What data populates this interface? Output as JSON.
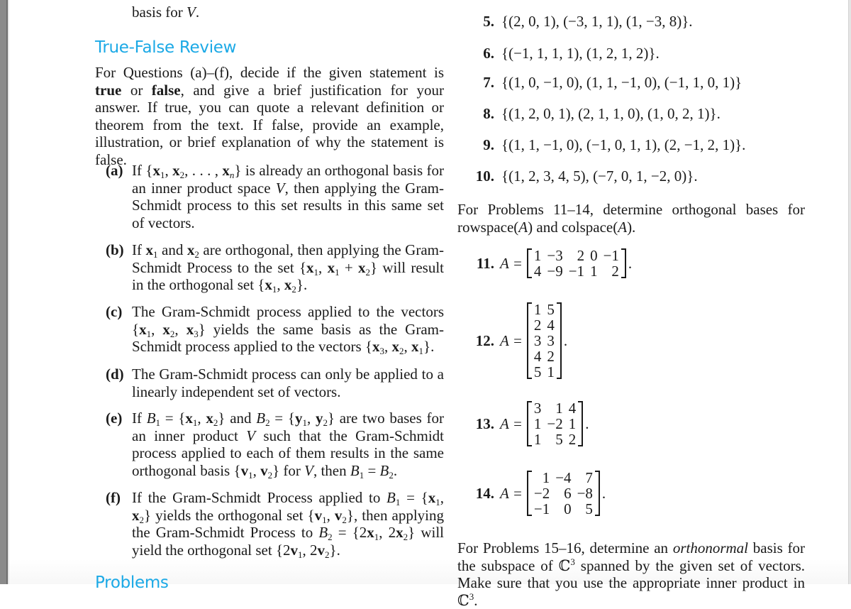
{
  "left_column": {
    "fragment_top": "basis for V.",
    "basis_for_prefix": "basis for ",
    "basis_for_var": "V",
    "basis_for_suffix": ".",
    "tf_heading": "True-False Review",
    "intro": {
      "p1": "For Questions (a)–(f), decide if the given statement is ",
      "true": "true",
      "p2": " or ",
      "false": "false",
      "p3": ", and give a brief justification for your answer. If true, you can quote a relevant definition or theorem from the text. If false, provide an example, illustration, or brief explanation of why the statement is false."
    },
    "items": [
      {
        "label": "(a)",
        "text": "If {x₁, x₂, …, xₙ} is already an orthogonal basis for an inner product space V, then applying the Gram-Schmidt process to this set results in this same set of vectors."
      },
      {
        "label": "(b)",
        "text": "If x₁ and x₂ are orthogonal, then applying the Gram-Schmidt Process to the set {x₁, x₁ + x₂} will result in the orthogonal set {x₁, x₂}."
      },
      {
        "label": "(c)",
        "text": "The Gram-Schmidt process applied to the vectors {x₁, x₂, x₃} yields the same basis as the Gram-Schmidt process applied to the vectors {x₃, x₂, x₁}."
      },
      {
        "label": "(d)",
        "text": "The Gram-Schmidt process can only be applied to a linearly independent set of vectors."
      },
      {
        "label": "(e)",
        "text": "If B₁ = {x₁, x₂} and B₂ = {y₁, y₂} are two bases for an inner product V such that the Gram-Schmidt process applied to each of them results in the same orthogonal basis {v₁, v₂} for V, then B₁ = B₂."
      },
      {
        "label": "(f)",
        "text": "If the Gram-Schmidt Process applied to B₁ = {x₁, x₂} yields the orthogonal set {v₁, v₂}, then applying the Gram-Schmidt Process to B₂ = {2x₁, 2x₂} will yield the orthogonal set {2v₁, 2v₂}."
      }
    ],
    "problems_heading": "Problems"
  },
  "right_column": {
    "vector_problems": [
      {
        "num": "5.",
        "text": "{(2, 0, 1), (−3, 1, 1), (1, −3, 8)}."
      },
      {
        "num": "6.",
        "text": "{(−1, 1, 1, 1), (1, 2, 1, 2)}."
      },
      {
        "num": "7.",
        "text": "{(1, 0, −1, 0), (1, 1, −1, 0), (−1, 1, 0, 1)}"
      },
      {
        "num": "8.",
        "text": "{(1, 2, 0, 1), (2, 1, 1, 0), (1, 0, 2, 1)}."
      },
      {
        "num": "9.",
        "text": "{(1, 1, −1, 0), (−1, 0, 1, 1), (2, −1, 2, 1)}."
      },
      {
        "num": "10.",
        "text": "{(1, 2, 3, 4, 5), (−7, 0, 1, −2, 0)}."
      }
    ],
    "para_11_14": {
      "p1": "For Problems 11–14, determine orthogonal bases for rowspace(",
      "A1": "A",
      "p2": ") and colspace(",
      "A2": "A",
      "p3": ")."
    },
    "matrix_lhs": "A =",
    "matrix_problems": [
      {
        "num": "11.",
        "rows": [
          [
            "1",
            "−3",
            "2",
            "0",
            "−1"
          ],
          [
            "4",
            "−9",
            "−1",
            "1",
            "2"
          ]
        ]
      },
      {
        "num": "12.",
        "rows": [
          [
            "1",
            "5"
          ],
          [
            "2",
            "4"
          ],
          [
            "3",
            "3"
          ],
          [
            "4",
            "2"
          ],
          [
            "5",
            "1"
          ]
        ]
      },
      {
        "num": "13.",
        "rows": [
          [
            "3",
            "1",
            "4"
          ],
          [
            "1",
            "−2",
            "1"
          ],
          [
            "1",
            "5",
            "2"
          ]
        ]
      },
      {
        "num": "14.",
        "rows": [
          [
            "1",
            "−4",
            "7"
          ],
          [
            "−2",
            "6",
            "−8"
          ],
          [
            "−1",
            "0",
            "5"
          ]
        ]
      }
    ],
    "para_15_16": {
      "p1": "For Problems 15–16, determine an ",
      "orthonormal": "orthonormal",
      "p2": " basis for the subspace of ℂ",
      "sup1": "3",
      "p3": " spanned by the given set of vectors. Make sure that you use the appropriate inner product in ℂ",
      "sup2": "3",
      "p4": "."
    }
  },
  "colors": {
    "heading": "#1ba9e6",
    "text": "#1a1a1a",
    "gutter": "#8a8a8a"
  }
}
